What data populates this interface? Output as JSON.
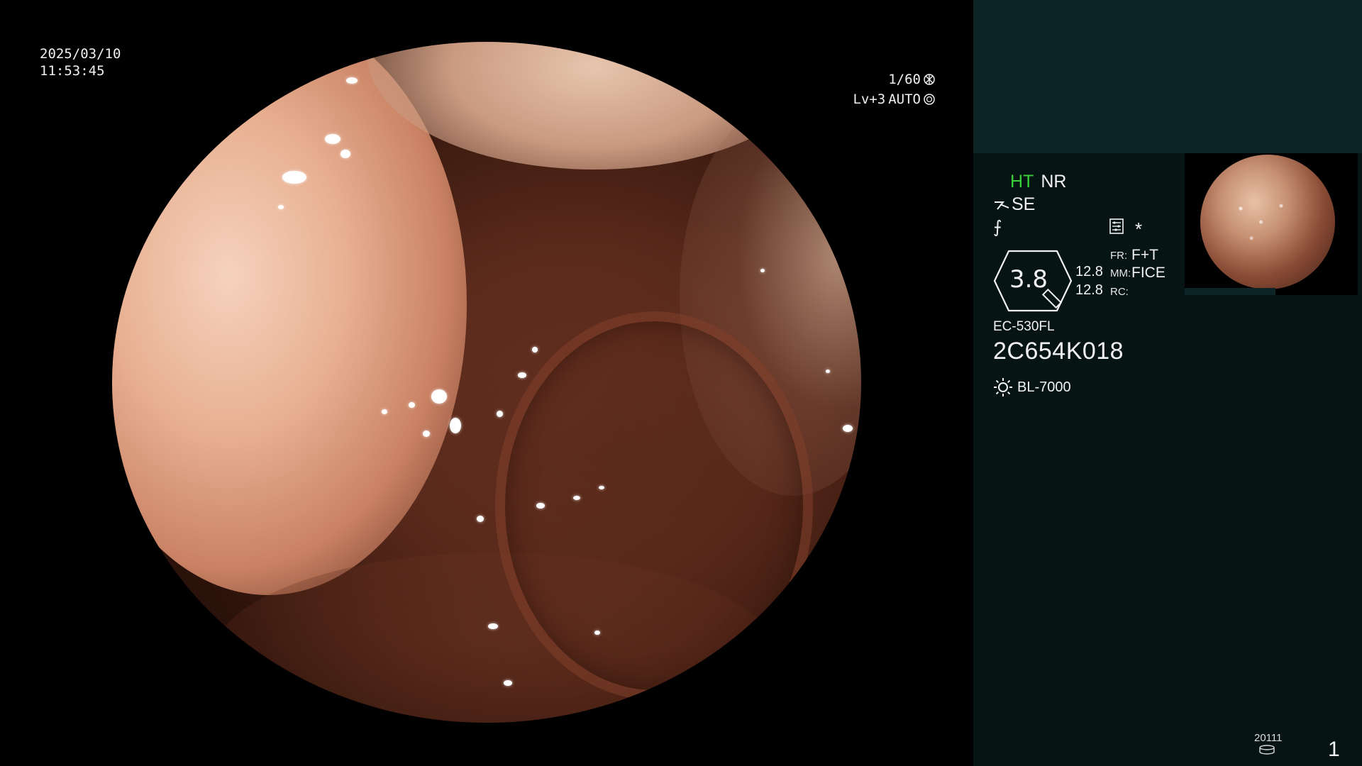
{
  "image_overlay": {
    "date": "2025/03/10",
    "time": "11:53:45",
    "shutter": "1/60",
    "shutter_icon": "aperture-icon",
    "level": "Lv+3",
    "mode": "AUTO",
    "mode_icon": "auto-exposure-icon"
  },
  "panel": {
    "mode_ht": "HT",
    "mode_nr": "NR",
    "se_label": "SE",
    "wave_glyph": "⨍",
    "asterisk": "*",
    "zoom_value": "3.8",
    "value_1": "12.8",
    "value_2": "12.8",
    "fr_label": "FR:",
    "fr_value": "F+T",
    "mm_label": "MM:",
    "mm_value": "FICE",
    "rc_label": "RC:",
    "scope_model": "EC-530FL",
    "scope_serial": "2C654K018",
    "light_source": "BL-7000",
    "light_icon": "light-source-icon",
    "footer_code": "20111",
    "page_number": "1"
  },
  "colors": {
    "ht_green": "#39d139",
    "panel_bg": "#061414",
    "panel_top_bg": "#0c2425"
  }
}
